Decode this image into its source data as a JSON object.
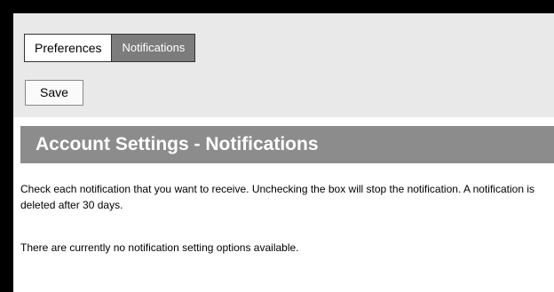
{
  "tabs": [
    {
      "label": "Preferences"
    },
    {
      "label": "Notifications"
    }
  ],
  "toolbar": {
    "save_label": "Save"
  },
  "page": {
    "title": "Account Settings - Notifications",
    "description": "Check each notification that you want to receive. Unchecking the box will stop the notification. A notification is deleted after 30 days.",
    "empty_message": "There are currently no notification setting options available."
  },
  "colors": {
    "active_tab": "#7c7c7c",
    "header_bg": "#8c8c8c",
    "toolbar_bg": "#e9e9e9"
  }
}
